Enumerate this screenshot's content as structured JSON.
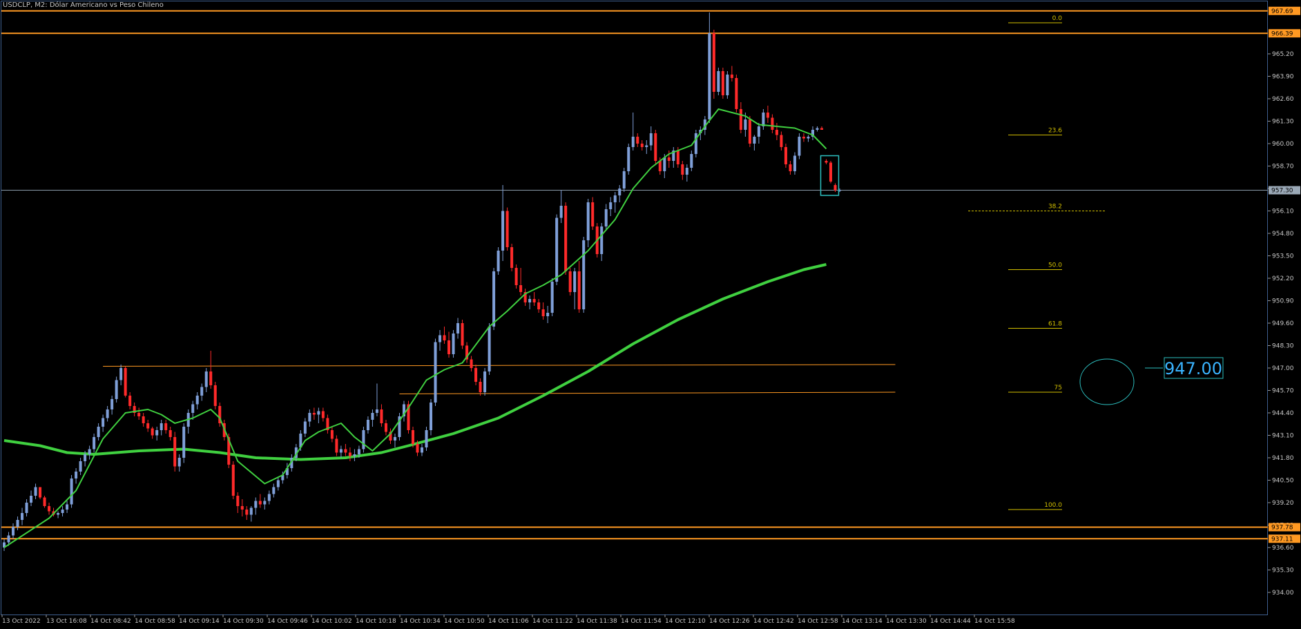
{
  "header": {
    "title": "USDCLP, M2:  Dólar Americano vs Peso Chileno"
  },
  "colors": {
    "background": "#000000",
    "frame": "#3f5f8f",
    "grid_text": "#c8c8c8",
    "bull": "#7f9fd8",
    "bear": "#ff2a2a",
    "ma_fast": "#40d040",
    "ma_slow": "#40d040",
    "level": "#ff9922",
    "fib": "#d4c000",
    "price_line": "#8a9aaa",
    "annotation": "#2dc0c0"
  },
  "chart_data": {
    "type": "candlestick",
    "symbol": "USDCLP",
    "timeframe": "M2",
    "ylim": [
      932.8,
      968.2
    ],
    "y_ticks": [
      "965.20",
      "963.90",
      "962.60",
      "961.30",
      "960.00",
      "958.70",
      "957.40",
      "956.10",
      "954.80",
      "953.50",
      "952.20",
      "950.90",
      "949.60",
      "948.30",
      "947.00",
      "945.70",
      "944.40",
      "943.10",
      "941.80",
      "940.50",
      "939.20",
      "937.90",
      "936.60",
      "935.30",
      "934.00"
    ],
    "x_ticks": [
      "13 Oct 2022",
      "13 Oct 16:08",
      "14 Oct 08:42",
      "14 Oct 08:58",
      "14 Oct 09:14",
      "14 Oct 09:30",
      "14 Oct 09:46",
      "14 Oct 10:02",
      "14 Oct 10:18",
      "14 Oct 10:34",
      "14 Oct 10:50",
      "14 Oct 11:06",
      "14 Oct 11:22",
      "14 Oct 11:38",
      "14 Oct 11:54",
      "14 Oct 12:10",
      "14 Oct 12:26",
      "14 Oct 12:42",
      "14 Oct 12:58",
      "14 Oct 13:14",
      "14 Oct 13:30",
      "14 Oct 14:44",
      "14 Oct 15:58"
    ],
    "candles": [
      [
        936.6,
        937.1,
        936.4,
        936.9
      ],
      [
        936.9,
        937.5,
        936.7,
        937.3
      ],
      [
        937.3,
        938.0,
        937.1,
        937.8
      ],
      [
        937.8,
        938.4,
        937.6,
        938.2
      ],
      [
        938.2,
        938.9,
        937.9,
        938.6
      ],
      [
        938.6,
        939.4,
        938.4,
        939.2
      ],
      [
        939.2,
        939.9,
        939.0,
        939.6
      ],
      [
        939.6,
        940.3,
        939.4,
        940.1
      ],
      [
        940.1,
        940.0,
        939.4,
        939.5
      ],
      [
        939.5,
        939.6,
        938.9,
        939.0
      ],
      [
        939.0,
        939.2,
        938.5,
        938.7
      ],
      [
        938.7,
        938.9,
        938.4,
        938.5
      ],
      [
        938.5,
        938.7,
        938.3,
        938.6
      ],
      [
        938.6,
        939.0,
        938.4,
        938.8
      ],
      [
        938.8,
        939.3,
        938.6,
        939.1
      ],
      [
        939.1,
        940.8,
        938.9,
        940.6
      ],
      [
        940.6,
        941.2,
        940.3,
        941.0
      ],
      [
        941.0,
        941.8,
        940.8,
        941.6
      ],
      [
        941.6,
        942.2,
        941.3,
        942.0
      ],
      [
        942.0,
        942.5,
        941.7,
        942.3
      ],
      [
        942.3,
        943.2,
        942.1,
        943.0
      ],
      [
        943.0,
        943.8,
        942.8,
        943.6
      ],
      [
        943.6,
        944.3,
        943.3,
        944.1
      ],
      [
        944.1,
        944.8,
        943.9,
        944.6
      ],
      [
        944.6,
        945.4,
        944.3,
        945.2
      ],
      [
        945.2,
        946.5,
        945.0,
        946.3
      ],
      [
        946.3,
        947.2,
        946.0,
        947.0
      ],
      [
        947.0,
        947.1,
        945.3,
        945.4
      ],
      [
        945.4,
        945.6,
        944.6,
        944.8
      ],
      [
        944.8,
        945.0,
        944.2,
        944.4
      ],
      [
        944.4,
        944.7,
        944.0,
        944.2
      ],
      [
        944.2,
        944.4,
        943.6,
        943.8
      ],
      [
        943.8,
        944.0,
        943.3,
        943.5
      ],
      [
        943.5,
        943.6,
        942.9,
        943.1
      ],
      [
        943.1,
        943.6,
        942.8,
        943.4
      ],
      [
        943.4,
        944.0,
        943.1,
        943.8
      ],
      [
        943.8,
        944.0,
        943.2,
        943.4
      ],
      [
        943.4,
        943.6,
        942.8,
        943.0
      ],
      [
        943.0,
        943.3,
        941.0,
        941.3
      ],
      [
        941.3,
        942.0,
        941.0,
        941.8
      ],
      [
        941.8,
        943.8,
        941.5,
        943.6
      ],
      [
        943.6,
        944.6,
        943.2,
        944.4
      ],
      [
        944.4,
        945.1,
        944.0,
        944.9
      ],
      [
        944.9,
        945.6,
        944.6,
        945.4
      ],
      [
        945.4,
        946.1,
        945.1,
        945.9
      ],
      [
        945.9,
        947.0,
        945.6,
        946.8
      ],
      [
        946.8,
        948.0,
        945.8,
        946.0
      ],
      [
        946.0,
        946.2,
        944.6,
        944.8
      ],
      [
        944.8,
        945.0,
        943.6,
        943.8
      ],
      [
        943.8,
        944.0,
        942.8,
        943.0
      ],
      [
        943.0,
        943.2,
        941.2,
        941.4
      ],
      [
        941.4,
        941.6,
        939.4,
        939.6
      ],
      [
        939.6,
        939.8,
        938.6,
        939.0
      ],
      [
        939.0,
        939.4,
        938.4,
        938.8
      ],
      [
        938.8,
        939.0,
        938.2,
        938.5
      ],
      [
        938.5,
        939.0,
        938.1,
        938.9
      ],
      [
        938.9,
        939.5,
        938.5,
        939.3
      ],
      [
        939.3,
        939.7,
        938.9,
        939.1
      ],
      [
        939.1,
        939.5,
        938.8,
        939.3
      ],
      [
        939.3,
        939.9,
        939.1,
        939.7
      ],
      [
        939.7,
        940.3,
        939.5,
        940.1
      ],
      [
        940.1,
        940.7,
        939.9,
        940.5
      ],
      [
        940.5,
        941.0,
        940.3,
        940.8
      ],
      [
        940.8,
        941.5,
        940.6,
        941.2
      ],
      [
        941.2,
        942.0,
        941.0,
        941.8
      ],
      [
        941.8,
        942.6,
        941.6,
        942.4
      ],
      [
        942.4,
        943.4,
        942.2,
        943.2
      ],
      [
        943.2,
        944.1,
        943.0,
        943.9
      ],
      [
        943.9,
        944.6,
        943.6,
        944.4
      ],
      [
        944.4,
        944.7,
        944.0,
        944.3
      ],
      [
        944.3,
        944.7,
        943.8,
        944.5
      ],
      [
        944.5,
        944.7,
        943.9,
        944.1
      ],
      [
        944.1,
        944.3,
        943.2,
        943.4
      ],
      [
        943.4,
        943.6,
        942.7,
        942.9
      ],
      [
        942.9,
        943.1,
        941.9,
        942.1
      ],
      [
        942.1,
        942.5,
        941.8,
        942.3
      ],
      [
        942.3,
        942.6,
        941.9,
        942.1
      ],
      [
        942.1,
        942.4,
        941.6,
        941.9
      ],
      [
        941.9,
        942.3,
        941.6,
        942.0
      ],
      [
        942.0,
        942.5,
        941.8,
        942.3
      ],
      [
        942.3,
        943.6,
        942.1,
        943.4
      ],
      [
        943.4,
        944.2,
        943.2,
        944.0
      ],
      [
        944.0,
        944.6,
        943.6,
        944.4
      ],
      [
        944.4,
        946.1,
        944.2,
        944.6
      ],
      [
        944.6,
        944.9,
        943.6,
        943.8
      ],
      [
        943.8,
        944.0,
        943.1,
        943.3
      ],
      [
        943.3,
        943.5,
        942.6,
        942.8
      ],
      [
        942.8,
        943.2,
        942.4,
        943.0
      ],
      [
        943.0,
        944.4,
        942.8,
        944.2
      ],
      [
        944.2,
        945.1,
        943.9,
        944.9
      ],
      [
        944.9,
        945.1,
        943.2,
        943.4
      ],
      [
        943.4,
        943.6,
        942.4,
        942.6
      ],
      [
        942.6,
        942.8,
        941.9,
        942.1
      ],
      [
        942.1,
        942.6,
        941.9,
        942.4
      ],
      [
        942.4,
        943.6,
        942.2,
        943.4
      ],
      [
        943.4,
        945.2,
        943.1,
        945.0
      ],
      [
        945.0,
        948.7,
        944.8,
        948.5
      ],
      [
        948.5,
        949.2,
        948.0,
        948.9
      ],
      [
        948.9,
        949.4,
        948.4,
        948.6
      ],
      [
        948.6,
        949.1,
        947.6,
        947.8
      ],
      [
        947.8,
        949.2,
        947.6,
        949.0
      ],
      [
        949.0,
        949.9,
        948.7,
        949.6
      ],
      [
        949.6,
        949.8,
        948.1,
        948.3
      ],
      [
        948.3,
        948.5,
        947.3,
        947.5
      ],
      [
        947.5,
        947.7,
        946.8,
        947.0
      ],
      [
        947.0,
        947.2,
        946.0,
        946.2
      ],
      [
        946.2,
        946.4,
        945.4,
        945.6
      ],
      [
        945.6,
        947.0,
        945.4,
        946.8
      ],
      [
        946.8,
        949.6,
        946.6,
        949.4
      ],
      [
        949.4,
        952.8,
        949.2,
        952.6
      ],
      [
        952.6,
        954.0,
        952.4,
        953.8
      ],
      [
        953.8,
        957.6,
        953.2,
        956.1
      ],
      [
        956.1,
        956.3,
        953.8,
        954.0
      ],
      [
        954.0,
        954.2,
        952.6,
        952.8
      ],
      [
        952.8,
        953.0,
        951.6,
        951.8
      ],
      [
        951.8,
        952.8,
        951.2,
        951.4
      ],
      [
        951.4,
        951.6,
        950.6,
        950.8
      ],
      [
        950.8,
        951.2,
        950.4,
        951.0
      ],
      [
        951.0,
        951.4,
        950.6,
        950.8
      ],
      [
        950.8,
        951.0,
        950.2,
        950.4
      ],
      [
        950.4,
        950.8,
        949.8,
        950.0
      ],
      [
        950.0,
        950.6,
        949.6,
        950.2
      ],
      [
        950.2,
        952.2,
        950.0,
        952.0
      ],
      [
        952.0,
        955.9,
        951.8,
        955.7
      ],
      [
        955.7,
        957.3,
        955.4,
        956.4
      ],
      [
        956.4,
        956.6,
        952.4,
        952.6
      ],
      [
        952.6,
        952.8,
        951.2,
        951.4
      ],
      [
        951.4,
        952.8,
        950.4,
        952.6
      ],
      [
        952.6,
        953.2,
        950.2,
        950.4
      ],
      [
        950.4,
        954.6,
        950.2,
        954.4
      ],
      [
        954.4,
        956.8,
        954.0,
        956.6
      ],
      [
        956.6,
        956.9,
        955.0,
        955.2
      ],
      [
        955.2,
        955.4,
        953.4,
        953.6
      ],
      [
        953.6,
        955.4,
        953.2,
        955.2
      ],
      [
        955.2,
        956.5,
        955.0,
        956.2
      ],
      [
        956.2,
        956.9,
        955.8,
        956.6
      ],
      [
        956.6,
        957.2,
        956.0,
        957.0
      ],
      [
        957.0,
        957.6,
        956.6,
        957.4
      ],
      [
        957.4,
        958.6,
        957.2,
        958.4
      ],
      [
        958.4,
        960.0,
        958.2,
        959.8
      ],
      [
        959.8,
        961.8,
        959.6,
        960.4
      ],
      [
        960.4,
        960.6,
        959.8,
        960.0
      ],
      [
        960.0,
        960.2,
        959.6,
        959.8
      ],
      [
        959.8,
        960.2,
        959.4,
        959.9
      ],
      [
        959.9,
        961.0,
        959.6,
        960.6
      ],
      [
        960.6,
        960.8,
        958.8,
        959.0
      ],
      [
        959.0,
        959.2,
        958.2,
        958.4
      ],
      [
        958.4,
        959.4,
        958.0,
        959.2
      ],
      [
        959.2,
        959.6,
        958.6,
        959.0
      ],
      [
        959.0,
        959.8,
        958.6,
        959.6
      ],
      [
        959.6,
        959.8,
        958.6,
        958.8
      ],
      [
        958.8,
        959.0,
        957.9,
        958.2
      ],
      [
        958.2,
        958.8,
        957.8,
        958.6
      ],
      [
        958.6,
        959.6,
        958.4,
        959.4
      ],
      [
        959.4,
        960.8,
        959.2,
        960.6
      ],
      [
        960.6,
        961.0,
        960.2,
        960.8
      ],
      [
        960.8,
        961.6,
        960.5,
        961.4
      ],
      [
        961.4,
        967.6,
        961.2,
        966.4
      ],
      [
        966.4,
        966.6,
        962.6,
        963.0
      ],
      [
        963.0,
        964.4,
        962.8,
        964.2
      ],
      [
        964.2,
        964.4,
        962.6,
        962.8
      ],
      [
        962.8,
        964.2,
        962.6,
        964.0
      ],
      [
        964.0,
        964.5,
        963.6,
        963.8
      ],
      [
        963.8,
        964.0,
        961.8,
        962.0
      ],
      [
        962.0,
        962.4,
        960.6,
        960.8
      ],
      [
        960.8,
        961.8,
        960.4,
        961.4
      ],
      [
        961.4,
        961.6,
        959.8,
        960.0
      ],
      [
        960.0,
        960.5,
        959.6,
        960.4
      ],
      [
        960.4,
        961.2,
        960.0,
        961.0
      ],
      [
        961.0,
        962.0,
        960.8,
        961.8
      ],
      [
        961.8,
        962.2,
        961.2,
        961.5
      ],
      [
        961.5,
        961.7,
        960.6,
        960.8
      ],
      [
        960.8,
        961.2,
        960.2,
        960.5
      ],
      [
        960.5,
        960.7,
        959.6,
        959.8
      ],
      [
        959.8,
        960.0,
        958.6,
        958.8
      ],
      [
        958.8,
        959.0,
        958.2,
        958.4
      ],
      [
        958.4,
        959.5,
        958.2,
        959.3
      ],
      [
        959.3,
        960.6,
        959.1,
        960.4
      ],
      [
        960.4,
        960.6,
        960.1,
        960.3
      ],
      [
        960.3,
        960.5,
        960.1,
        960.4
      ],
      [
        960.4,
        961.0,
        960.2,
        960.8
      ],
      [
        960.8,
        961.0,
        960.7,
        960.9
      ],
      [
        960.9,
        961.0,
        960.8,
        960.8
      ],
      [
        959.0,
        959.1,
        958.8,
        958.9
      ],
      [
        958.9,
        959.0,
        957.7,
        957.8
      ],
      [
        957.6,
        957.7,
        957.2,
        957.3
      ],
      [
        957.3,
        957.4,
        957.2,
        957.3
      ]
    ],
    "ma_fast": [
      [
        0,
        936.6
      ],
      [
        10,
        938.3
      ],
      [
        16,
        939.9
      ],
      [
        22,
        942.9
      ],
      [
        27,
        944.4
      ],
      [
        32,
        944.6
      ],
      [
        35,
        944.3
      ],
      [
        38,
        943.8
      ],
      [
        42,
        944.1
      ],
      [
        46,
        944.6
      ],
      [
        48,
        944.1
      ],
      [
        52,
        941.6
      ],
      [
        58,
        940.3
      ],
      [
        62,
        940.8
      ],
      [
        67,
        942.8
      ],
      [
        70,
        943.3
      ],
      [
        75,
        943.8
      ],
      [
        78,
        943.0
      ],
      [
        82,
        942.2
      ],
      [
        86,
        943.2
      ],
      [
        90,
        944.7
      ],
      [
        94,
        946.3
      ],
      [
        98,
        946.9
      ],
      [
        102,
        947.3
      ],
      [
        108,
        949.4
      ],
      [
        112,
        950.3
      ],
      [
        116,
        951.3
      ],
      [
        120,
        951.8
      ],
      [
        124,
        952.4
      ],
      [
        130,
        953.8
      ],
      [
        136,
        955.6
      ],
      [
        140,
        957.4
      ],
      [
        144,
        958.6
      ],
      [
        148,
        959.4
      ],
      [
        153,
        959.9
      ],
      [
        156,
        961.0
      ],
      [
        159,
        962.0
      ],
      [
        162,
        961.8
      ],
      [
        165,
        961.6
      ],
      [
        168,
        961.1
      ],
      [
        172,
        961.0
      ],
      [
        176,
        960.9
      ],
      [
        180,
        960.5
      ],
      [
        183,
        959.7
      ]
    ],
    "ma_slow": [
      [
        0,
        942.8
      ],
      [
        8,
        942.5
      ],
      [
        14,
        942.1
      ],
      [
        20,
        942.0
      ],
      [
        30,
        942.2
      ],
      [
        40,
        942.3
      ],
      [
        48,
        942.1
      ],
      [
        56,
        941.8
      ],
      [
        66,
        941.7
      ],
      [
        76,
        941.8
      ],
      [
        84,
        942.1
      ],
      [
        90,
        942.5
      ],
      [
        100,
        943.2
      ],
      [
        110,
        944.1
      ],
      [
        120,
        945.4
      ],
      [
        130,
        946.8
      ],
      [
        140,
        948.4
      ],
      [
        150,
        949.8
      ],
      [
        160,
        951.0
      ],
      [
        170,
        952.0
      ],
      [
        178,
        952.7
      ],
      [
        183,
        953.0
      ]
    ],
    "levels": [
      {
        "price": 967.69,
        "label": "967.69"
      },
      {
        "price": 966.39,
        "label": "966.39"
      },
      {
        "price": 937.78,
        "label": "937.78"
      },
      {
        "price": 937.11,
        "label": "937.11"
      }
    ],
    "current_price": {
      "price": 957.3,
      "label": "957.30"
    },
    "fib_levels": [
      {
        "label": "0.0",
        "price": 967.0
      },
      {
        "label": "23.6",
        "price": 960.5
      },
      {
        "label": "38.2",
        "price": 956.1
      },
      {
        "label": "50.0",
        "price": 952.7
      },
      {
        "label": "61.8",
        "price": 949.3
      },
      {
        "label": "75",
        "price": 945.6
      },
      {
        "label": "100.0",
        "price": 938.8
      }
    ],
    "trendlines": [
      {
        "from": [
          22,
          947.1
        ],
        "to": [
          183,
          947.2
        ]
      },
      {
        "from": [
          88,
          945.5
        ],
        "to": [
          183,
          945.6
        ]
      }
    ],
    "annotation": {
      "label": "947.00"
    }
  }
}
